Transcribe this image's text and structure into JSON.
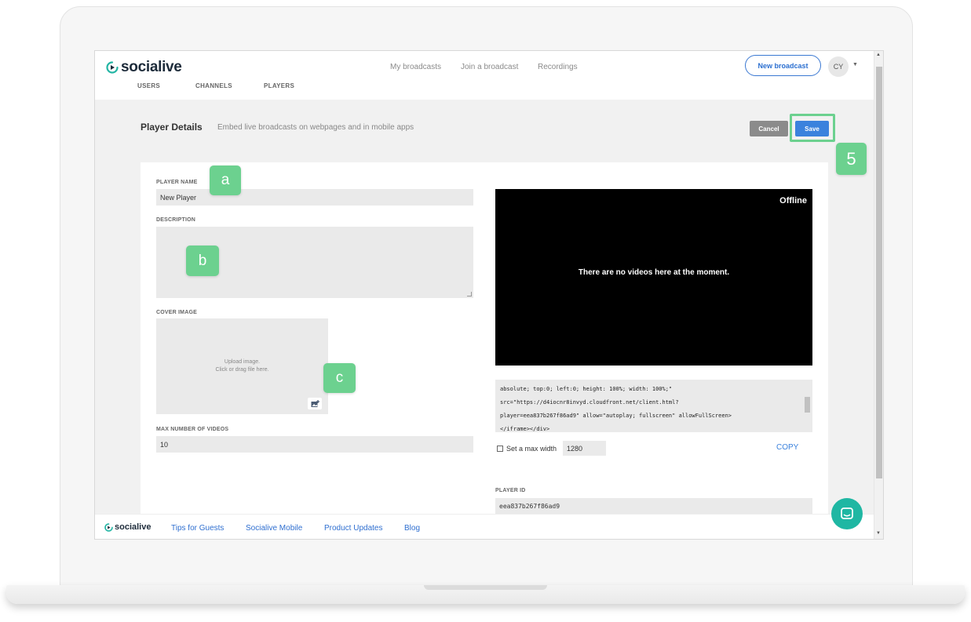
{
  "header": {
    "brand": "socialive",
    "subnav": [
      "USERS",
      "CHANNELS",
      "PLAYERS"
    ],
    "topnav": [
      "My broadcasts",
      "Join a broadcast",
      "Recordings"
    ],
    "new_broadcast_label": "New broadcast",
    "avatar_initials": "CY"
  },
  "page": {
    "title": "Player Details",
    "subtitle": "Embed live broadcasts on webpages and in mobile apps",
    "cancel_label": "Cancel",
    "save_label": "Save"
  },
  "form": {
    "player_name_label": "PLAYER NAME",
    "player_name_value": "New Player",
    "description_label": "DESCRIPTION",
    "cover_image_label": "COVER IMAGE",
    "cover_upload_line1": "Upload image.",
    "cover_upload_line2": "Click or drag file here.",
    "max_videos_label": "MAX NUMBER OF VIDEOS",
    "max_videos_value": "10"
  },
  "preview": {
    "status": "Offline",
    "empty_message": "There are no videos here at the moment."
  },
  "embed": {
    "code_lines": [
      "absolute; top:0; left:0; height: 100%; width: 100%;\"",
      "src=\"https://d4iocnr8invyd.cloudfront.net/client.html?",
      "player=eea837b267f86ad9\" allow=\"autoplay; fullscreen\" allowFullScreen>",
      "</iframe></div>"
    ],
    "max_width_label": "Set a max width",
    "max_width_value": "1280",
    "copy_label": "COPY",
    "player_id_label": "PLAYER ID",
    "player_id_value": "eea837b267f86ad9"
  },
  "footer": {
    "brand": "socialive",
    "links": [
      "Tips for Guests",
      "Socialive Mobile",
      "Product Updates",
      "Blog"
    ]
  },
  "annotations": {
    "a": "a",
    "b": "b",
    "c": "c",
    "step": "5"
  },
  "colors": {
    "accent": "#3b82dd",
    "annotation": "#6cd18f",
    "chat": "#1fb7a3",
    "brand_icon": "#23b5a4"
  },
  "icons": {
    "logo": "play-logo-icon",
    "upload": "image-upload-icon",
    "chat": "chat-icon"
  }
}
